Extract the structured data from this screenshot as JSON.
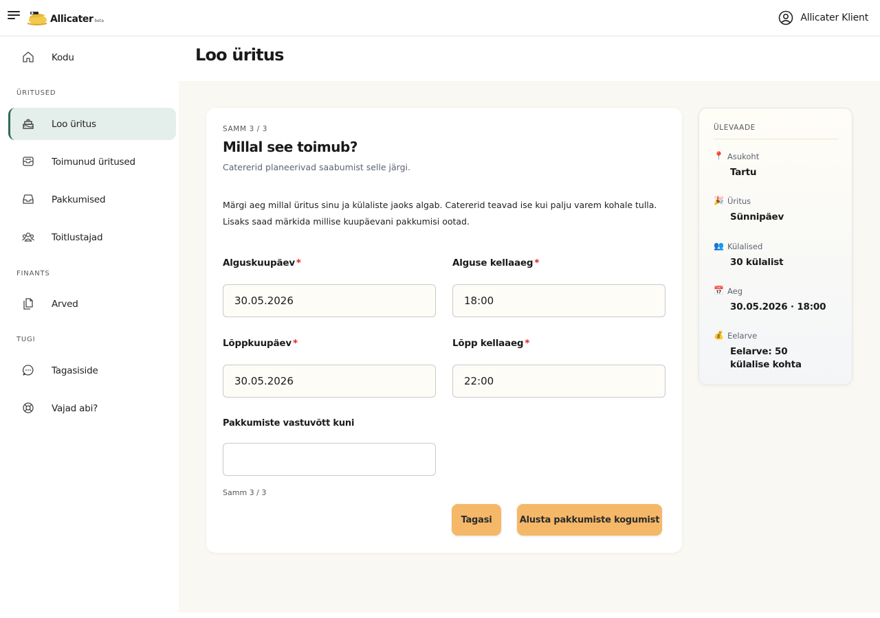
{
  "header": {
    "brand": "Allicater",
    "beta": "beta",
    "user_name": "Allicater Klient"
  },
  "sidebar": {
    "items_top": [
      {
        "label": "Kodu",
        "icon": "home-icon"
      }
    ],
    "section_events": "ÜRITUSED",
    "events": [
      {
        "label": "Loo üritus",
        "icon": "cake-icon",
        "active": true
      },
      {
        "label": "Toimunud üritused",
        "icon": "tray-icon"
      },
      {
        "label": "Pakkumised",
        "icon": "inbox-icon"
      },
      {
        "label": "Toitlustajad",
        "icon": "users-icon"
      }
    ],
    "section_finance": "FINANTS",
    "finance": [
      {
        "label": "Arved",
        "icon": "documents-icon"
      }
    ],
    "section_support": "TUGI",
    "support": [
      {
        "label": "Tagasiside",
        "icon": "chat-icon"
      },
      {
        "label": "Vajad abi?",
        "icon": "lifebuoy-icon"
      }
    ]
  },
  "page": {
    "title": "Loo üritus"
  },
  "form": {
    "step": "SAMM 3 / 3",
    "title": "Millal see toimub?",
    "subtitle": "Catererid planeerivad saabumist selle järgi.",
    "description": "Märgi aeg millal üritus sinu ja külaliste jaoks algab. Catererid teavad ise kui palju varem kohale tulla. Lisaks saad märkida millise kuupäevani pakkumisi ootad.",
    "start_date_label": "Alguskuupäev",
    "start_date_value": "30.05.2026",
    "start_time_label": "Alguse kellaaeg",
    "start_time_value": "18:00",
    "end_date_label": "Lõppkuupäev",
    "end_date_value": "30.05.2026",
    "end_time_label": "Lõpp kellaaeg",
    "end_time_value": "22:00",
    "deadline_label": "Pakkumiste vastuvõtt kuni",
    "deadline_value": "",
    "required_mark": "*",
    "step_footer": "Samm 3 / 3",
    "back_label": "Tagasi",
    "submit_label": "Alusta pakkumiste kogumist"
  },
  "overview": {
    "title": "ÜLEVAADE",
    "items": [
      {
        "emoji": "📍",
        "key": "Asukoht",
        "value": "Tartu"
      },
      {
        "emoji": "🎉",
        "key": "Üritus",
        "value": "Sünnipäev"
      },
      {
        "emoji": "👥",
        "key": "Külalised",
        "value": "30 külalist"
      },
      {
        "emoji": "📅",
        "key": "Aeg",
        "value": "30.05.2026 · 18:00"
      },
      {
        "emoji": "💰",
        "key": "Eelarve",
        "value": "Eelarve: 50 külalise kohta"
      }
    ]
  },
  "colors": {
    "accent": "#2e6b57",
    "active_bg": "#e4eeea",
    "button": "#f5b869",
    "required": "#e02020",
    "main_bg": "#faf8f3"
  }
}
